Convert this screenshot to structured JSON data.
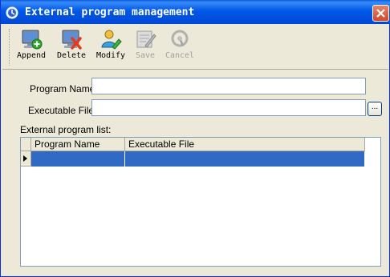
{
  "window": {
    "title": "External program management",
    "colors": {
      "titlebar": "#0058e6",
      "selection": "#316ac5",
      "close": "#d14828"
    }
  },
  "toolbar": {
    "buttons": [
      {
        "label": "Append",
        "icon": "append-icon",
        "enabled": true
      },
      {
        "label": "Delete",
        "icon": "delete-icon",
        "enabled": true
      },
      {
        "label": "Modify",
        "icon": "modify-icon",
        "enabled": true
      },
      {
        "label": "Save",
        "icon": "save-icon",
        "enabled": false
      },
      {
        "label": "Cancel",
        "icon": "cancel-icon",
        "enabled": false
      }
    ]
  },
  "form": {
    "program_name_label": "Program Name:",
    "program_name_value": "",
    "executable_file_label": "Executable File:",
    "executable_file_value": "",
    "browse_label": "..."
  },
  "list": {
    "label": "External program list:",
    "columns": [
      "Program Name",
      "Executable File"
    ],
    "rows": [
      {
        "program_name": "",
        "executable_file": "",
        "selected": true
      }
    ]
  }
}
